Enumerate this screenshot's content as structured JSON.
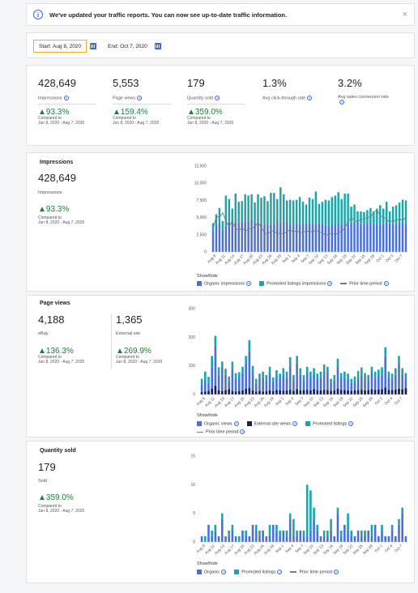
{
  "banner": {
    "text": "We've updated your traffic reports. You can now see up-to-date traffic information.",
    "close": "×"
  },
  "dates": {
    "start": "Start: Aug 8, 2020",
    "end": "End: Oct 7, 2020"
  },
  "kpis": [
    {
      "value": "428,649",
      "label": "Impressions",
      "pct": "93.3%",
      "cmp1": "Compared to",
      "cmp2": "Jun 8, 2020 - Aug 7, 2020"
    },
    {
      "value": "5,553",
      "label": "Page views",
      "pct": "159.4%",
      "cmp1": "Compared to",
      "cmp2": "Jun 8, 2020 - Aug 7, 2020"
    },
    {
      "value": "179",
      "label": "Quantity sold",
      "pct": "359.0%",
      "cmp1": "Compared to",
      "cmp2": "Jun 8, 2020 - Aug 7, 2020"
    },
    {
      "value": "1.3%",
      "label": "Avg click-through rate"
    },
    {
      "value": "3.2%",
      "label": "Avg sales conversion rate"
    }
  ],
  "impressions": {
    "title": "Impressions",
    "value": "428,649",
    "label": "Impressions",
    "pct": "93.3%",
    "cmp1": "Compared to",
    "cmp2": "Jun 8, 2020 - Aug 7, 2020",
    "showhide": "Show/hide",
    "legend": [
      "Organic impressions",
      "Promoted listings impressions",
      "Prior time period"
    ]
  },
  "pageviews": {
    "title": "Page views",
    "v1": "4,188",
    "l1": "eBay",
    "p1": "136.3%",
    "v2": "1,365",
    "l2": "External site",
    "p2": "269.9%",
    "cmp1": "Compared to",
    "cmp2": "Jun 8, 2020 - Aug 7, 2020",
    "showhide": "Show/hide",
    "legend": [
      "Organic views",
      "External site views",
      "Promoted listings",
      "Prior time period"
    ]
  },
  "qsold": {
    "title": "Quantity sold",
    "value": "179",
    "label": "Sold",
    "pct": "359.0%",
    "cmp1": "Compared to",
    "cmp2": "Jun 8, 2020 - Aug 7, 2020",
    "showhide": "Show/hide",
    "legend": [
      "Organic",
      "Promoted listings",
      "Prior time period"
    ]
  },
  "colors": {
    "organic": "#4a6fd8",
    "promoted": "#1aa6a6",
    "external": "#1b1f4a",
    "prior": "#7a7a7a",
    "up": "#1a7f37",
    "accent": "#3665f3"
  },
  "chart_data": [
    {
      "type": "bar",
      "title": "Impressions",
      "ylim": [
        0,
        12500
      ],
      "yticks": [
        "12,500",
        "10,000",
        "7,500",
        "5,000",
        "2,500",
        "0"
      ],
      "x": [
        "Aug 8",
        "Aug 11",
        "Aug 14",
        "Aug 17",
        "Aug 20",
        "Aug 23",
        "Aug 26",
        "Aug 29",
        "Sep 1",
        "Sep 4",
        "Sep 7",
        "Sep 10",
        "Sep 13",
        "Sep 16",
        "Sep 19",
        "Sep 22",
        "Sep 25",
        "Sep 28",
        "Oct 1",
        "Oct 4",
        "Oct 7"
      ],
      "series": [
        {
          "name": "Organic impressions",
          "values": [
            3000,
            4000,
            4200,
            3000,
            3800,
            4400,
            3900,
            4300,
            4200,
            4300,
            4400,
            4500,
            4600,
            4200,
            4100,
            4200,
            4100,
            3900,
            4000,
            4100,
            4300,
            4200,
            4400,
            4300,
            4100,
            4000,
            4200,
            4100,
            4000,
            4300,
            4200,
            4100,
            4000,
            4200,
            4100,
            4000,
            3800,
            3900,
            4000,
            4200,
            4100,
            4000,
            4100,
            4200,
            4300,
            4400,
            4100,
            4000,
            4200,
            4300,
            4100,
            4000,
            4200,
            4100,
            4300,
            4200,
            4100,
            4000,
            4200,
            4300,
            4100
          ]
        },
        {
          "name": "Promoted listings impressions",
          "values": [
            1200,
            1500,
            2200,
            1500,
            4400,
            3300,
            2400,
            4200,
            3100,
            3100,
            4000,
            3700,
            3800,
            3000,
            4300,
            3700,
            4000,
            3500,
            4600,
            4500,
            3400,
            5200,
            4000,
            3200,
            3500,
            3500,
            3400,
            3900,
            3300,
            2600,
            3700,
            3600,
            4800,
            2800,
            3200,
            3600,
            3700,
            4100,
            4200,
            4500,
            3600,
            4500,
            4400,
            2400,
            2600,
            1500,
            1800,
            1800,
            1900,
            2100,
            1800,
            2300,
            2600,
            2200,
            3000,
            1700,
            2500,
            2800,
            3000,
            3300,
            3400
          ]
        },
        {
          "name": "Prior time period",
          "values": [
            3300,
            5200,
            5000,
            5700,
            4500,
            3700,
            4500,
            3300,
            3200,
            3500,
            3000,
            3300,
            3400,
            3700,
            4300,
            3600,
            2800,
            2600,
            3100,
            3000,
            2700,
            2700,
            2600,
            3000,
            3200,
            2900,
            3100,
            2800,
            2900,
            3000,
            3000,
            2900,
            3200,
            2900,
            2800,
            2400,
            2600,
            2700,
            2500,
            2800,
            3000,
            3500,
            4400,
            5000,
            4600,
            4400,
            4800,
            4700,
            5100,
            5000,
            5800,
            6100,
            5300,
            5100,
            4700,
            4400,
            4500,
            4600,
            4800,
            4600,
            5000
          ]
        }
      ]
    },
    {
      "type": "bar",
      "title": "Page views",
      "ylim": [
        0,
        300
      ],
      "yticks": [
        "300",
        "200",
        "100",
        "0"
      ],
      "x": [
        "Aug 8",
        "Aug 11",
        "Aug 14",
        "Aug 17",
        "Aug 20",
        "Aug 23",
        "Aug 26",
        "Aug 29",
        "Sep 1",
        "Sep 4",
        "Sep 7",
        "Sep 10",
        "Sep 13",
        "Sep 16",
        "Sep 19",
        "Sep 22",
        "Sep 25",
        "Sep 28",
        "Oct 1",
        "Oct 4",
        "Oct 7"
      ],
      "series": [
        {
          "name": "Organic views",
          "values": [
            35,
            50,
            40,
            95,
            170,
            70,
            95,
            70,
            45,
            90,
            55,
            60,
            75,
            110,
            150,
            75,
            40,
            55,
            60,
            50,
            75,
            45,
            65,
            55,
            70,
            60,
            100,
            50,
            110,
            70,
            50,
            75,
            60,
            70,
            55,
            60,
            80,
            75,
            40,
            50,
            100,
            55,
            60,
            55,
            40,
            45,
            60,
            70,
            55,
            50,
            75,
            60,
            65,
            70,
            135,
            60,
            55,
            70,
            110,
            70,
            55
          ]
        },
        {
          "name": "External site views",
          "values": [
            8,
            10,
            12,
            20,
            30,
            14,
            12,
            15,
            18,
            12,
            10,
            12,
            14,
            20,
            22,
            14,
            10,
            12,
            10,
            12,
            14,
            12,
            15,
            14,
            13,
            14,
            16,
            12,
            18,
            14,
            15,
            16,
            14,
            18,
            15,
            14,
            16,
            15,
            12,
            14,
            20,
            16,
            15,
            14,
            12,
            14,
            15,
            16,
            14,
            15,
            18,
            16,
            17,
            18,
            24,
            16,
            15,
            17,
            20,
            18,
            22
          ]
        },
        {
          "name": "Promoted listings",
          "values": [
            20,
            30,
            22,
            40,
            35,
            25,
            20,
            20,
            18,
            25,
            20,
            18,
            22,
            25,
            40,
            25,
            15,
            18,
            20,
            18,
            22,
            15,
            20,
            18,
            22,
            20,
            30,
            18,
            25,
            22,
            18,
            22,
            20,
            22,
            18,
            20,
            25,
            22,
            15,
            18,
            25,
            20,
            20,
            18,
            15,
            18,
            22,
            25,
            20,
            18,
            22,
            20,
            22,
            25,
            30,
            20,
            18,
            22,
            25,
            22,
            20
          ]
        }
      ]
    },
    {
      "type": "bar",
      "title": "Quantity sold",
      "ylim": [
        0,
        15
      ],
      "yticks": [
        "15",
        "10",
        "5",
        "0"
      ],
      "x": [
        "Aug 8",
        "Aug 11",
        "Aug 14",
        "Aug 17",
        "Aug 20",
        "Aug 23",
        "Aug 26",
        "Aug 29",
        "Sep 1",
        "Sep 4",
        "Sep 7",
        "Sep 10",
        "Sep 13",
        "Sep 16",
        "Sep 19",
        "Sep 22",
        "Sep 25",
        "Sep 28",
        "Oct 1",
        "Oct 4",
        "Oct 7"
      ],
      "series": [
        {
          "name": "Organic",
          "values": [
            1,
            0,
            3,
            1,
            2,
            1,
            4,
            1,
            1,
            2,
            1,
            0,
            2,
            1,
            1,
            3,
            2,
            1,
            2,
            1,
            1,
            3,
            2,
            1,
            2,
            1,
            4,
            1,
            1,
            2,
            1,
            1,
            2,
            4,
            2,
            1,
            1,
            1,
            2,
            1,
            5,
            1,
            3,
            2,
            1,
            1,
            2,
            1,
            1,
            2,
            1,
            3,
            1,
            2,
            1,
            1,
            2,
            1,
            3,
            5,
            1
          ]
        },
        {
          "name": "Promoted listings",
          "values": [
            0,
            1,
            0,
            1,
            1,
            0,
            1,
            0,
            1,
            1,
            0,
            1,
            0,
            1,
            0,
            0,
            1,
            1,
            0,
            0,
            2,
            0,
            1,
            1,
            0,
            1,
            1,
            3,
            1,
            0,
            1,
            9,
            7,
            2,
            1,
            0,
            1,
            1,
            2,
            0,
            1,
            1,
            0,
            3,
            1,
            0,
            0,
            1,
            1,
            0,
            2,
            0,
            0,
            1,
            0,
            0,
            1,
            0,
            1,
            1,
            0
          ]
        }
      ]
    }
  ]
}
